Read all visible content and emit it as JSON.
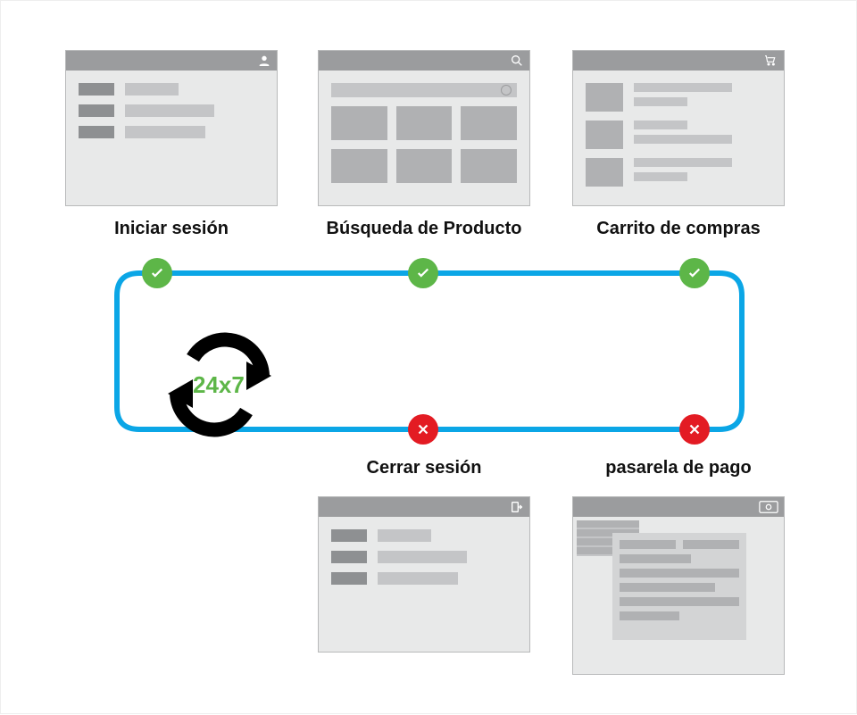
{
  "steps": {
    "login": {
      "label": "Iniciar sesión",
      "status": "ok"
    },
    "search": {
      "label": "Búsqueda de Producto",
      "status": "ok"
    },
    "cart": {
      "label": "Carrito de compras",
      "status": "ok"
    },
    "payment": {
      "label": "pasarela de pago",
      "status": "err"
    },
    "logout": {
      "label": "Cerrar sesión",
      "status": "err"
    }
  },
  "cycle": {
    "label": "24x7"
  },
  "icons": {
    "user": "user-icon",
    "search": "search-icon",
    "cart": "cart-icon",
    "logout": "logout-icon",
    "money": "money-icon"
  },
  "colors": {
    "flowline": "#0ba6e6",
    "ok": "#5db648",
    "err": "#e31b23",
    "cycle_text": "#5db648"
  }
}
